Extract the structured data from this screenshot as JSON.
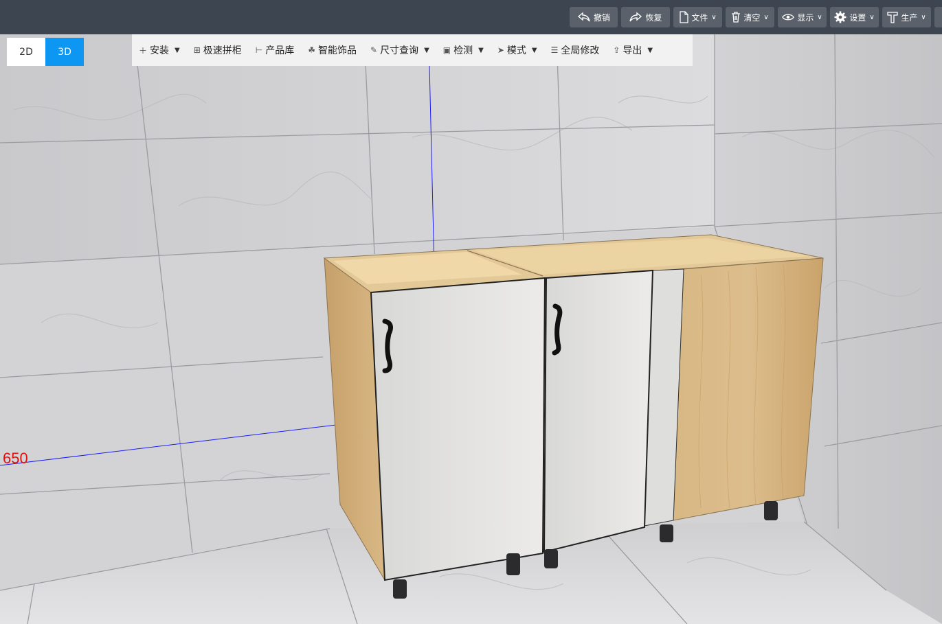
{
  "topbar": {
    "buttons": [
      {
        "label": "撤销",
        "icon": "undo-icon"
      },
      {
        "label": "恢复",
        "icon": "redo-icon"
      },
      {
        "label": "文件",
        "icon": "file-icon"
      },
      {
        "label": "清空",
        "icon": "trash-icon"
      },
      {
        "label": "显示",
        "icon": "eye-icon"
      },
      {
        "label": "设置",
        "icon": "gear-icon"
      },
      {
        "label": "生产",
        "icon": "hammer-icon"
      }
    ]
  },
  "view_toggle": {
    "d2": "2D",
    "d3": "3D",
    "active": "3D"
  },
  "toolbar": {
    "install": "安装",
    "quick_cabinet": "极速拼柜",
    "product_library": "产品库",
    "smart_decor": "智能饰品",
    "dimension_query": "尺寸查询",
    "detect": "检测",
    "mode": "模式",
    "global_edit": "全局修改",
    "export": "导出"
  },
  "scene": {
    "dimension_label": "650"
  },
  "colors": {
    "accent": "#0d96f2",
    "topbar": "#3d4550",
    "dimension": "#e21010",
    "guide_line": "#1a1aff"
  }
}
